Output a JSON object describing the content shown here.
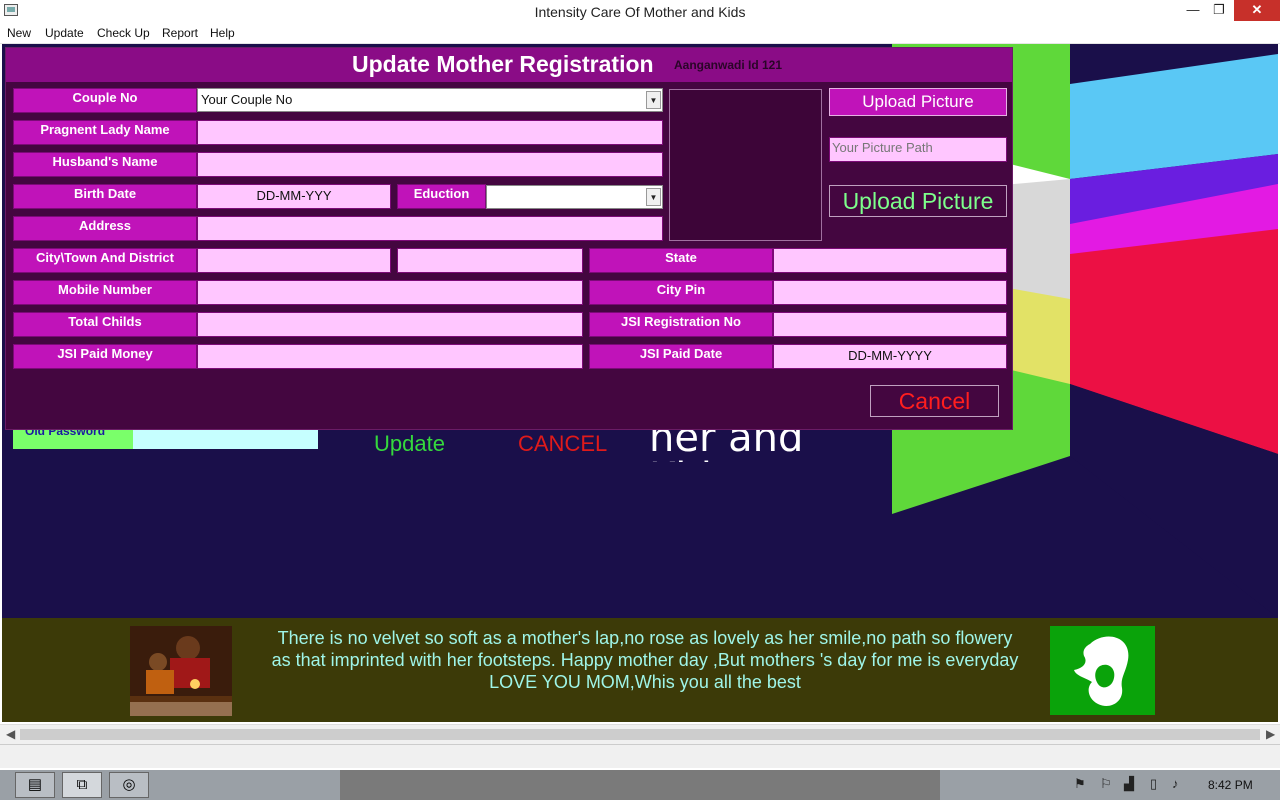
{
  "window": {
    "title": "Intensity Care Of Mother and Kids",
    "minimize": "—",
    "maximize": "❐",
    "close": "✕"
  },
  "menu": [
    "New",
    "Update",
    "Check Up",
    "Report",
    "Help"
  ],
  "dialog": {
    "title": "Update Mother Registration",
    "subtitle": "Aanganwadi Id 121",
    "labels": {
      "couple_no": "Couple No",
      "pregnant_lady_name": "Pragnent Lady Name",
      "husband_name": "Husband's Name",
      "birth_date": "Birth Date",
      "education": "Eduction",
      "address": "Address",
      "city": "City\\Town And District",
      "state": "State",
      "mobile": "Mobile Number",
      "city_pin": "City Pin",
      "total_childs": "Total Childs",
      "jsi_registration_no": "JSI Registration No",
      "jsi_paid_money": "JSI Paid Money",
      "jsi_paid_date": "JSI Paid Date"
    },
    "values": {
      "couple_no": "Your Couple No",
      "pregnant_lady_name": "",
      "husband_name": "",
      "birth_date": "DD-MM-YYY",
      "education": "",
      "address": "",
      "city": "",
      "district": "",
      "state": "",
      "mobile": "",
      "city_pin": "",
      "total_childs": "",
      "jsi_registration_no": "",
      "jsi_paid_money": "",
      "jsi_paid_date": "DD-MM-YYYY"
    },
    "upload_picture_label": "Upload Picture",
    "picture_path_placeholder": "Your Picture Path",
    "upload_picture_label_2": "Upload Picture",
    "cancel_label": "Cancel"
  },
  "background": {
    "old_password_label": "Old Password",
    "update_label": "Update",
    "cancel_label": "CANCEL",
    "banner_text": "her and Kids"
  },
  "footer": {
    "quote": "There is no velvet so soft as a mother's lap,no rose as lovely as her smile,no path so flowery as that imprinted with her footsteps. Happy mother day ,But mothers 's day for me is everyday LOVE YOU MOM,Whis you all the best"
  },
  "taskbar": {
    "clock": "8:42 PM",
    "icons": [
      "file-explorer-icon",
      "app-window-icon",
      "browser-icon"
    ]
  },
  "colors": {
    "dialog_bg": "#440640",
    "label_bg": "#c013b9",
    "field_bg": "#ffc6ff",
    "client_bg": "#1a0f4a",
    "cancel_red": "#ff1e1e",
    "upload_green": "#7dff8b"
  }
}
